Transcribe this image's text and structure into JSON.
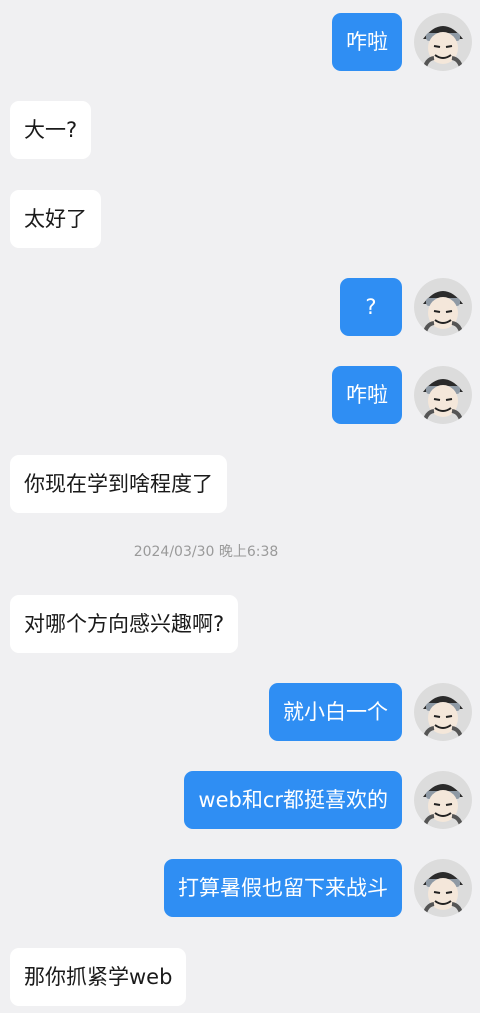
{
  "messages": [
    {
      "side": "out",
      "text": "咋啦",
      "avatar_icon": "user-avatar-icon"
    },
    {
      "side": "in",
      "text": "大一?"
    },
    {
      "side": "in",
      "text": "太好了"
    },
    {
      "side": "out",
      "text": "?",
      "avatar_icon": "user-avatar-icon"
    },
    {
      "side": "out",
      "text": "咋啦",
      "avatar_icon": "user-avatar-icon"
    },
    {
      "side": "in",
      "text": "你现在学到啥程度了"
    },
    {
      "side": "in",
      "text": "对哪个方向感兴趣啊?"
    },
    {
      "side": "out",
      "text": "就小白一个",
      "avatar_icon": "user-avatar-icon"
    },
    {
      "side": "out",
      "text": "web和cr都挺喜欢的",
      "avatar_icon": "user-avatar-icon"
    },
    {
      "side": "out",
      "text": "打算暑假也留下来战斗",
      "avatar_icon": "user-avatar-icon"
    },
    {
      "side": "in",
      "text": "那你抓紧学web"
    }
  ],
  "timestamp": "2024/03/30 晚上6:38",
  "colors": {
    "background": "#f0f0f2",
    "outgoing_bubble": "#2f8ef3",
    "incoming_bubble": "#ffffff"
  }
}
